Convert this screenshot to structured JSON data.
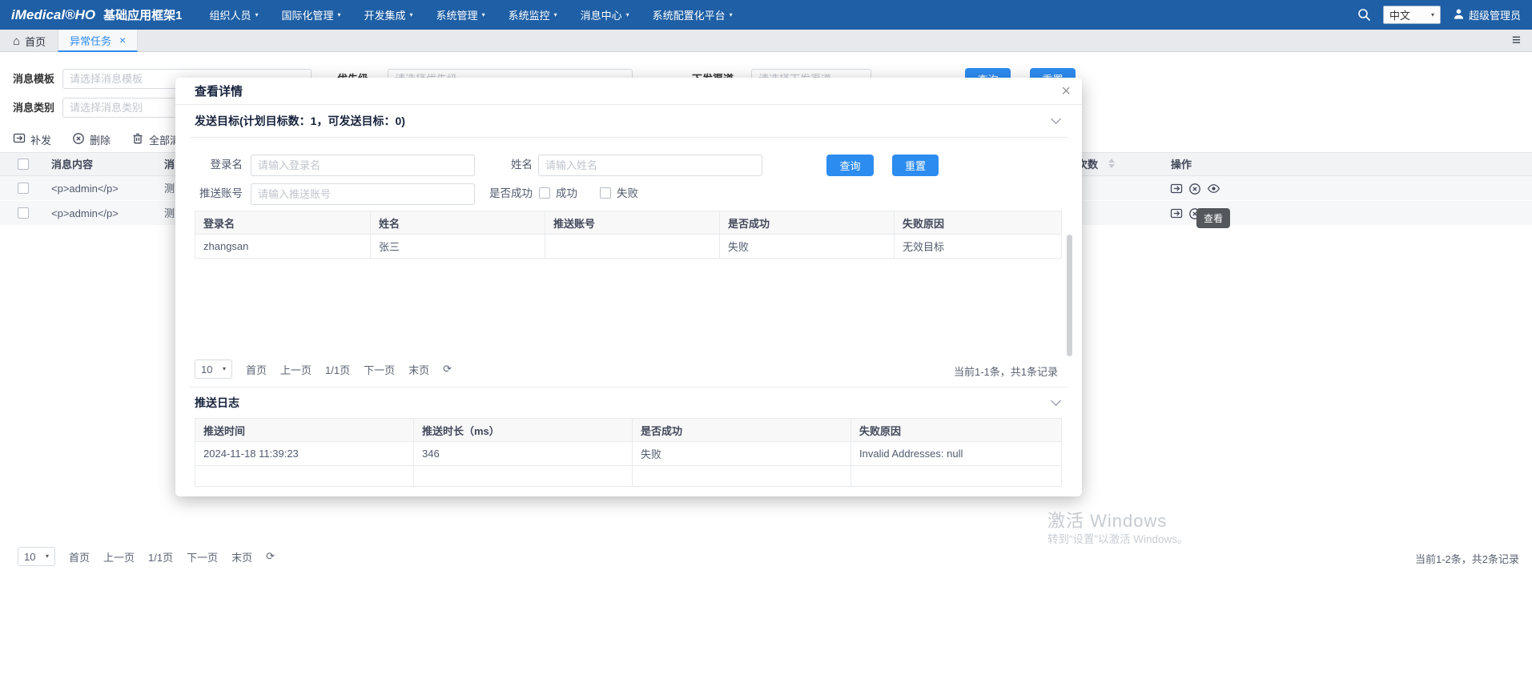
{
  "icons": {
    "caret_down": "▾",
    "close": "×",
    "home": "⌂",
    "refresh": "⟳",
    "hamburger": "≡"
  },
  "navbar": {
    "logo": "iMedical®HO",
    "app_title": "基础应用框架1",
    "menus": [
      "组织人员",
      "国际化管理",
      "开发集成",
      "系统管理",
      "系统监控",
      "消息中心",
      "系统配置化平台"
    ],
    "language": "中文",
    "user": "超级管理员"
  },
  "tabs": {
    "home": "首页",
    "active": "异常任务"
  },
  "filters": {
    "template_label": "消息模板",
    "template_placeholder": "请选择消息模板",
    "priority_label": "优先级",
    "priority_placeholder": "请选择优先级",
    "channel_label": "下发渠道",
    "channel_placeholder": "请选择下发渠道",
    "category_label": "消息类别",
    "category_placeholder": "请选择消息类别",
    "query": "查询",
    "reset": "重置"
  },
  "toolbar": {
    "resend": "补发",
    "delete": "删除",
    "clear_all": "全部清空"
  },
  "message_table": {
    "col_content": "消息内容",
    "col_partial": "消",
    "col_count": "次数",
    "col_action": "操作",
    "rows": [
      {
        "content": "<p>admin</p>",
        "partial": "测"
      },
      {
        "content": "<p>admin</p>",
        "partial": "测"
      }
    ],
    "view_tooltip": "查看"
  },
  "page_pagination": {
    "size": "10",
    "first": "首页",
    "prev": "上一页",
    "current": "1/1页",
    "next": "下一页",
    "last": "末页",
    "total": "当前1-2条，共2条记录"
  },
  "modal": {
    "title": "查看详情",
    "section_target": "发送目标(计划目标数：1，可发送目标：0)",
    "form": {
      "login_label": "登录名",
      "login_placeholder": "请输入登录名",
      "name_label": "姓名",
      "name_placeholder": "请输入姓名",
      "push_label": "推送账号",
      "push_placeholder": "请输入推送账号",
      "success_label": "是否成功",
      "cb_success": "成功",
      "cb_fail": "失败",
      "query": "查询",
      "reset": "重置"
    },
    "target_table": {
      "headers": [
        "登录名",
        "姓名",
        "推送账号",
        "是否成功",
        "失败原因"
      ],
      "rows": [
        [
          "zhangsan",
          "张三",
          "",
          "失败",
          "无效目标"
        ]
      ]
    },
    "target_pagination": {
      "size": "10",
      "first": "首页",
      "prev": "上一页",
      "current": "1/1页",
      "next": "下一页",
      "last": "末页",
      "total": "当前1-1条，共1条记录"
    },
    "section_log": "推送日志",
    "log_table": {
      "headers": [
        "推送时间",
        "推送时长（ms）",
        "是否成功",
        "失败原因"
      ],
      "rows": [
        [
          "2024-11-18 11:39:23",
          "346",
          "失败",
          "Invalid Addresses: null"
        ]
      ]
    }
  },
  "watermark": {
    "line1": "激活 Windows",
    "line2": "转到“设置”以激活 Windows。"
  },
  "colors": {
    "primary": "#2d8cf0",
    "navbar": "#1e5fa6"
  }
}
